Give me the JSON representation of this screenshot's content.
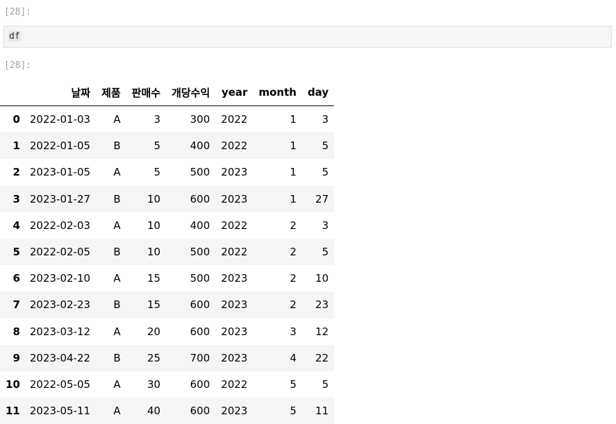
{
  "input_prompt": "[28]:",
  "code": "df",
  "output_prompt": "[28]:",
  "table": {
    "columns": [
      "날짜",
      "제품",
      "판매수",
      "개당수익",
      "year",
      "month",
      "day"
    ],
    "rows": [
      {
        "index": "0",
        "cells": [
          "2022-01-03",
          "A",
          "3",
          "300",
          "2022",
          "1",
          "3"
        ]
      },
      {
        "index": "1",
        "cells": [
          "2022-01-05",
          "B",
          "5",
          "400",
          "2022",
          "1",
          "5"
        ]
      },
      {
        "index": "2",
        "cells": [
          "2023-01-05",
          "A",
          "5",
          "500",
          "2023",
          "1",
          "5"
        ]
      },
      {
        "index": "3",
        "cells": [
          "2023-01-27",
          "B",
          "10",
          "600",
          "2023",
          "1",
          "27"
        ]
      },
      {
        "index": "4",
        "cells": [
          "2022-02-03",
          "A",
          "10",
          "400",
          "2022",
          "2",
          "3"
        ]
      },
      {
        "index": "5",
        "cells": [
          "2022-02-05",
          "B",
          "10",
          "500",
          "2022",
          "2",
          "5"
        ]
      },
      {
        "index": "6",
        "cells": [
          "2023-02-10",
          "A",
          "15",
          "500",
          "2023",
          "2",
          "10"
        ]
      },
      {
        "index": "7",
        "cells": [
          "2023-02-23",
          "B",
          "15",
          "600",
          "2023",
          "2",
          "23"
        ]
      },
      {
        "index": "8",
        "cells": [
          "2023-03-12",
          "A",
          "20",
          "600",
          "2023",
          "3",
          "12"
        ]
      },
      {
        "index": "9",
        "cells": [
          "2023-04-22",
          "B",
          "25",
          "700",
          "2023",
          "4",
          "22"
        ]
      },
      {
        "index": "10",
        "cells": [
          "2022-05-05",
          "A",
          "30",
          "600",
          "2022",
          "5",
          "5"
        ]
      },
      {
        "index": "11",
        "cells": [
          "2023-05-11",
          "A",
          "40",
          "600",
          "2023",
          "5",
          "11"
        ]
      }
    ]
  }
}
